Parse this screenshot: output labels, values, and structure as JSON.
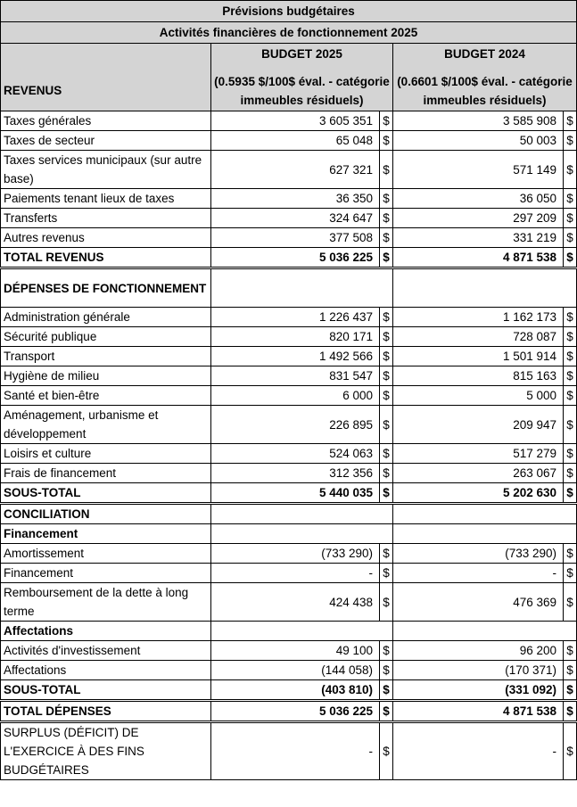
{
  "title": "Prévisions budgétaires",
  "subtitle": "Activités financières de fonctionnement 2025",
  "header": {
    "revenus_label": "REVENUS",
    "col2025_title": "BUDGET 2025",
    "col2025_desc": "(0.5935 $/100$ éval. - catégorie immeubles résiduels)",
    "col2024_title": "BUDGET 2024",
    "col2024_desc": "(0.6601 $/100$ éval. - catégorie immeubles résiduels)"
  },
  "currency": "$",
  "revenus": [
    {
      "label": "Taxes générales",
      "b2025": "3 605 351",
      "b2024": "3 585 908"
    },
    {
      "label": "Taxes de secteur",
      "b2025": "65 048",
      "b2024": "50 003"
    },
    {
      "label": "Taxes services municipaux (sur autre base)",
      "b2025": "627 321",
      "b2024": "571 149"
    },
    {
      "label": "Paiements tenant lieux de taxes",
      "b2025": "36 350",
      "b2024": "36 050"
    },
    {
      "label": "Transferts",
      "b2025": "324 647",
      "b2024": "297 209"
    },
    {
      "label": "Autres revenus",
      "b2025": "377 508",
      "b2024": "331 219"
    }
  ],
  "total_revenus": {
    "label": "TOTAL REVENUS",
    "b2025": "5 036 225",
    "b2024": "4 871 538"
  },
  "depenses_header": "DÉPENSES DE FONCTIONNEMENT",
  "depenses": [
    {
      "label": "Administration générale",
      "b2025": "1 226 437",
      "b2024": "1 162 173"
    },
    {
      "label": "Sécurité publique",
      "b2025": "820 171",
      "b2024": "728 087"
    },
    {
      "label": "Transport",
      "b2025": "1 492 566",
      "b2024": "1 501 914"
    },
    {
      "label": "Hygiène de milieu",
      "b2025": "831 547",
      "b2024": "815 163"
    },
    {
      "label": "Santé et bien-être",
      "b2025": "6 000",
      "b2024": "5 000"
    },
    {
      "label": "Aménagement, urbanisme et développement",
      "b2025": "226 895",
      "b2024": "209 947"
    },
    {
      "label": "Loisirs et culture",
      "b2025": "524 063",
      "b2024": "517 279"
    },
    {
      "label": "Frais de financement",
      "b2025": "312 356",
      "b2024": "263 067"
    }
  ],
  "sous_total_1": {
    "label": "SOUS-TOTAL",
    "b2025": "5 440 035",
    "b2024": "5 202 630"
  },
  "conciliation_header": "CONCILIATION",
  "financement_header": "Financement",
  "financement": [
    {
      "label": "Amortissement",
      "b2025": "(733 290)",
      "b2024": "(733 290)"
    },
    {
      "label": "Financement",
      "b2025": "-",
      "b2024": "-"
    },
    {
      "label": "Remboursement de la dette à long terme",
      "b2025": "424 438",
      "b2024": "476 369"
    }
  ],
  "affectations_header": "Affectations",
  "affectations": [
    {
      "label": "Activités d'investissement",
      "b2025": "49 100",
      "b2024": "96 200"
    },
    {
      "label": "Affectations",
      "b2025": "(144 058)",
      "b2024": "(170 371)"
    }
  ],
  "sous_total_2": {
    "label": "SOUS-TOTAL",
    "b2025": "(403 810)",
    "b2024": "(331 092)"
  },
  "total_depenses": {
    "label": "TOTAL DÉPENSES",
    "b2025": "5 036 225",
    "b2024": "4 871 538"
  },
  "surplus": {
    "label": "SURPLUS (DÉFICIT) DE L'EXERCICE À DES FINS BUDGÉTAIRES",
    "b2025": "-",
    "b2024": "-"
  }
}
